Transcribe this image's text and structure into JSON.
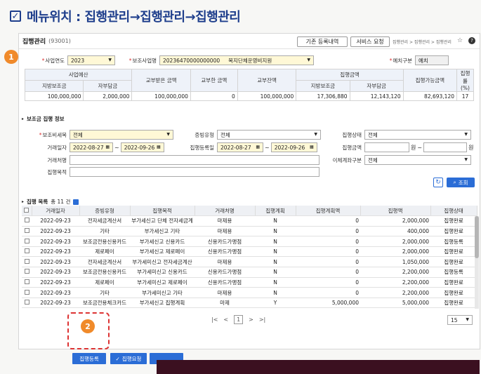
{
  "heading": {
    "check_icon": "✓",
    "text": "메뉴위치 : 집행관리→집행관리→집행관리"
  },
  "topbar": {
    "title": "집행관리",
    "code": "(93001)",
    "btn_history": "기존 등록내역",
    "btn_service": "서비스 요청",
    "breadcrumb": "집행관리 > 집행관리 > 집행관리"
  },
  "markers": {
    "m1": "1",
    "m2": "2"
  },
  "filters": {
    "year_label": "사업연도",
    "year_value": "2023",
    "sub_label": "보조사업명",
    "sub_value": "20236470000000000",
    "sub_value2": "복지단체운영비지원",
    "account_label": "예치구분",
    "account_value": "예치"
  },
  "summary": {
    "headers": {
      "budget": "사업예산",
      "local": "지방보조금",
      "self": "자부담금",
      "received": "교부받은 금액",
      "returned": "교부한 금액",
      "balance": "교부잔액",
      "exec": "집행금액",
      "exec_local": "지방보조금",
      "exec_self": "자부담금",
      "available": "집행가능금액",
      "rate": "집행률 (%)"
    },
    "values": {
      "local": "100,000,000",
      "self": "2,000,000",
      "received": "100,000,000",
      "returned": "0",
      "balance": "100,000,000",
      "exec_local": "17,306,880",
      "exec_self": "12,143,120",
      "available": "82,693,120",
      "rate": "17"
    }
  },
  "search": {
    "section_title": "보조금 집행 정보",
    "item_label": "보조비세목",
    "item_value": "전체",
    "evid_label": "증빙유형",
    "evid_value": "전체",
    "status_label": "집행상태",
    "status_value": "전체",
    "txdate_label": "거래일자",
    "tx_from": "2022-08-27",
    "tx_to": "2022-09-26",
    "regdate_label": "집행등록일",
    "reg_from": "2022-08-27",
    "reg_to": "2022-09-26",
    "amount_label": "집행금액",
    "won1": "원",
    "won2": "원",
    "tilde": "~",
    "vendor_label": "거래처명",
    "transfer_label": "이체계좌구분",
    "transfer_value": "전체",
    "purpose_label": "집행목적",
    "search_btn": "조회",
    "reset_icon": "↻"
  },
  "list": {
    "title": "집행 목록",
    "count": "총 11 건",
    "headers": [
      "거래일자",
      "증빙유형",
      "집행목적",
      "거래처명",
      "집행계획",
      "집행계획액",
      "집행액",
      "집행상태"
    ],
    "rows": [
      [
        "2022-09-23",
        "전자세금계산서",
        "부가세신고 단체 전자세금계",
        "마제용",
        "N",
        "0",
        "2,000,000",
        "집행완료"
      ],
      [
        "2022-09-23",
        "기타",
        "부가세신고 기타",
        "마제용",
        "N",
        "0",
        "400,000",
        "집행완료"
      ],
      [
        "2022-09-23",
        "보조금전용신용카드",
        "부가세신고 신용카드",
        "신용카드가맹점",
        "N",
        "0",
        "2,000,000",
        "집행등록"
      ],
      [
        "2022-09-23",
        "제로페이",
        "부가세신고 제로페이",
        "신용카드가맹점",
        "N",
        "0",
        "2,000,000",
        "집행완료"
      ],
      [
        "2022-09-23",
        "전자세금계산서",
        "부가세미신고 전자세금계산",
        "마제용",
        "N",
        "0",
        "1,050,000",
        "집행완료"
      ],
      [
        "2022-09-23",
        "보조금전용신용카드",
        "부가세미신고 신용카드",
        "신용카드가맹점",
        "N",
        "0",
        "2,200,000",
        "집행등록"
      ],
      [
        "2022-09-23",
        "제로페이",
        "부가세미신고 제로페이",
        "신용카드가맹점",
        "N",
        "0",
        "2,200,000",
        "집행완료"
      ],
      [
        "2022-09-23",
        "기타",
        "부가세미신고 기타",
        "마제용",
        "N",
        "0",
        "2,200,000",
        "집행완료"
      ],
      [
        "2022-09-23",
        "보조금전용체크카드",
        "부가세신고 집행계획",
        "마제",
        "Y",
        "5,000,000",
        "5,000,000",
        "집행완료"
      ]
    ],
    "page": "1",
    "page_size": "15"
  },
  "bottom": {
    "register": "집행등록",
    "request": "집행요청"
  }
}
